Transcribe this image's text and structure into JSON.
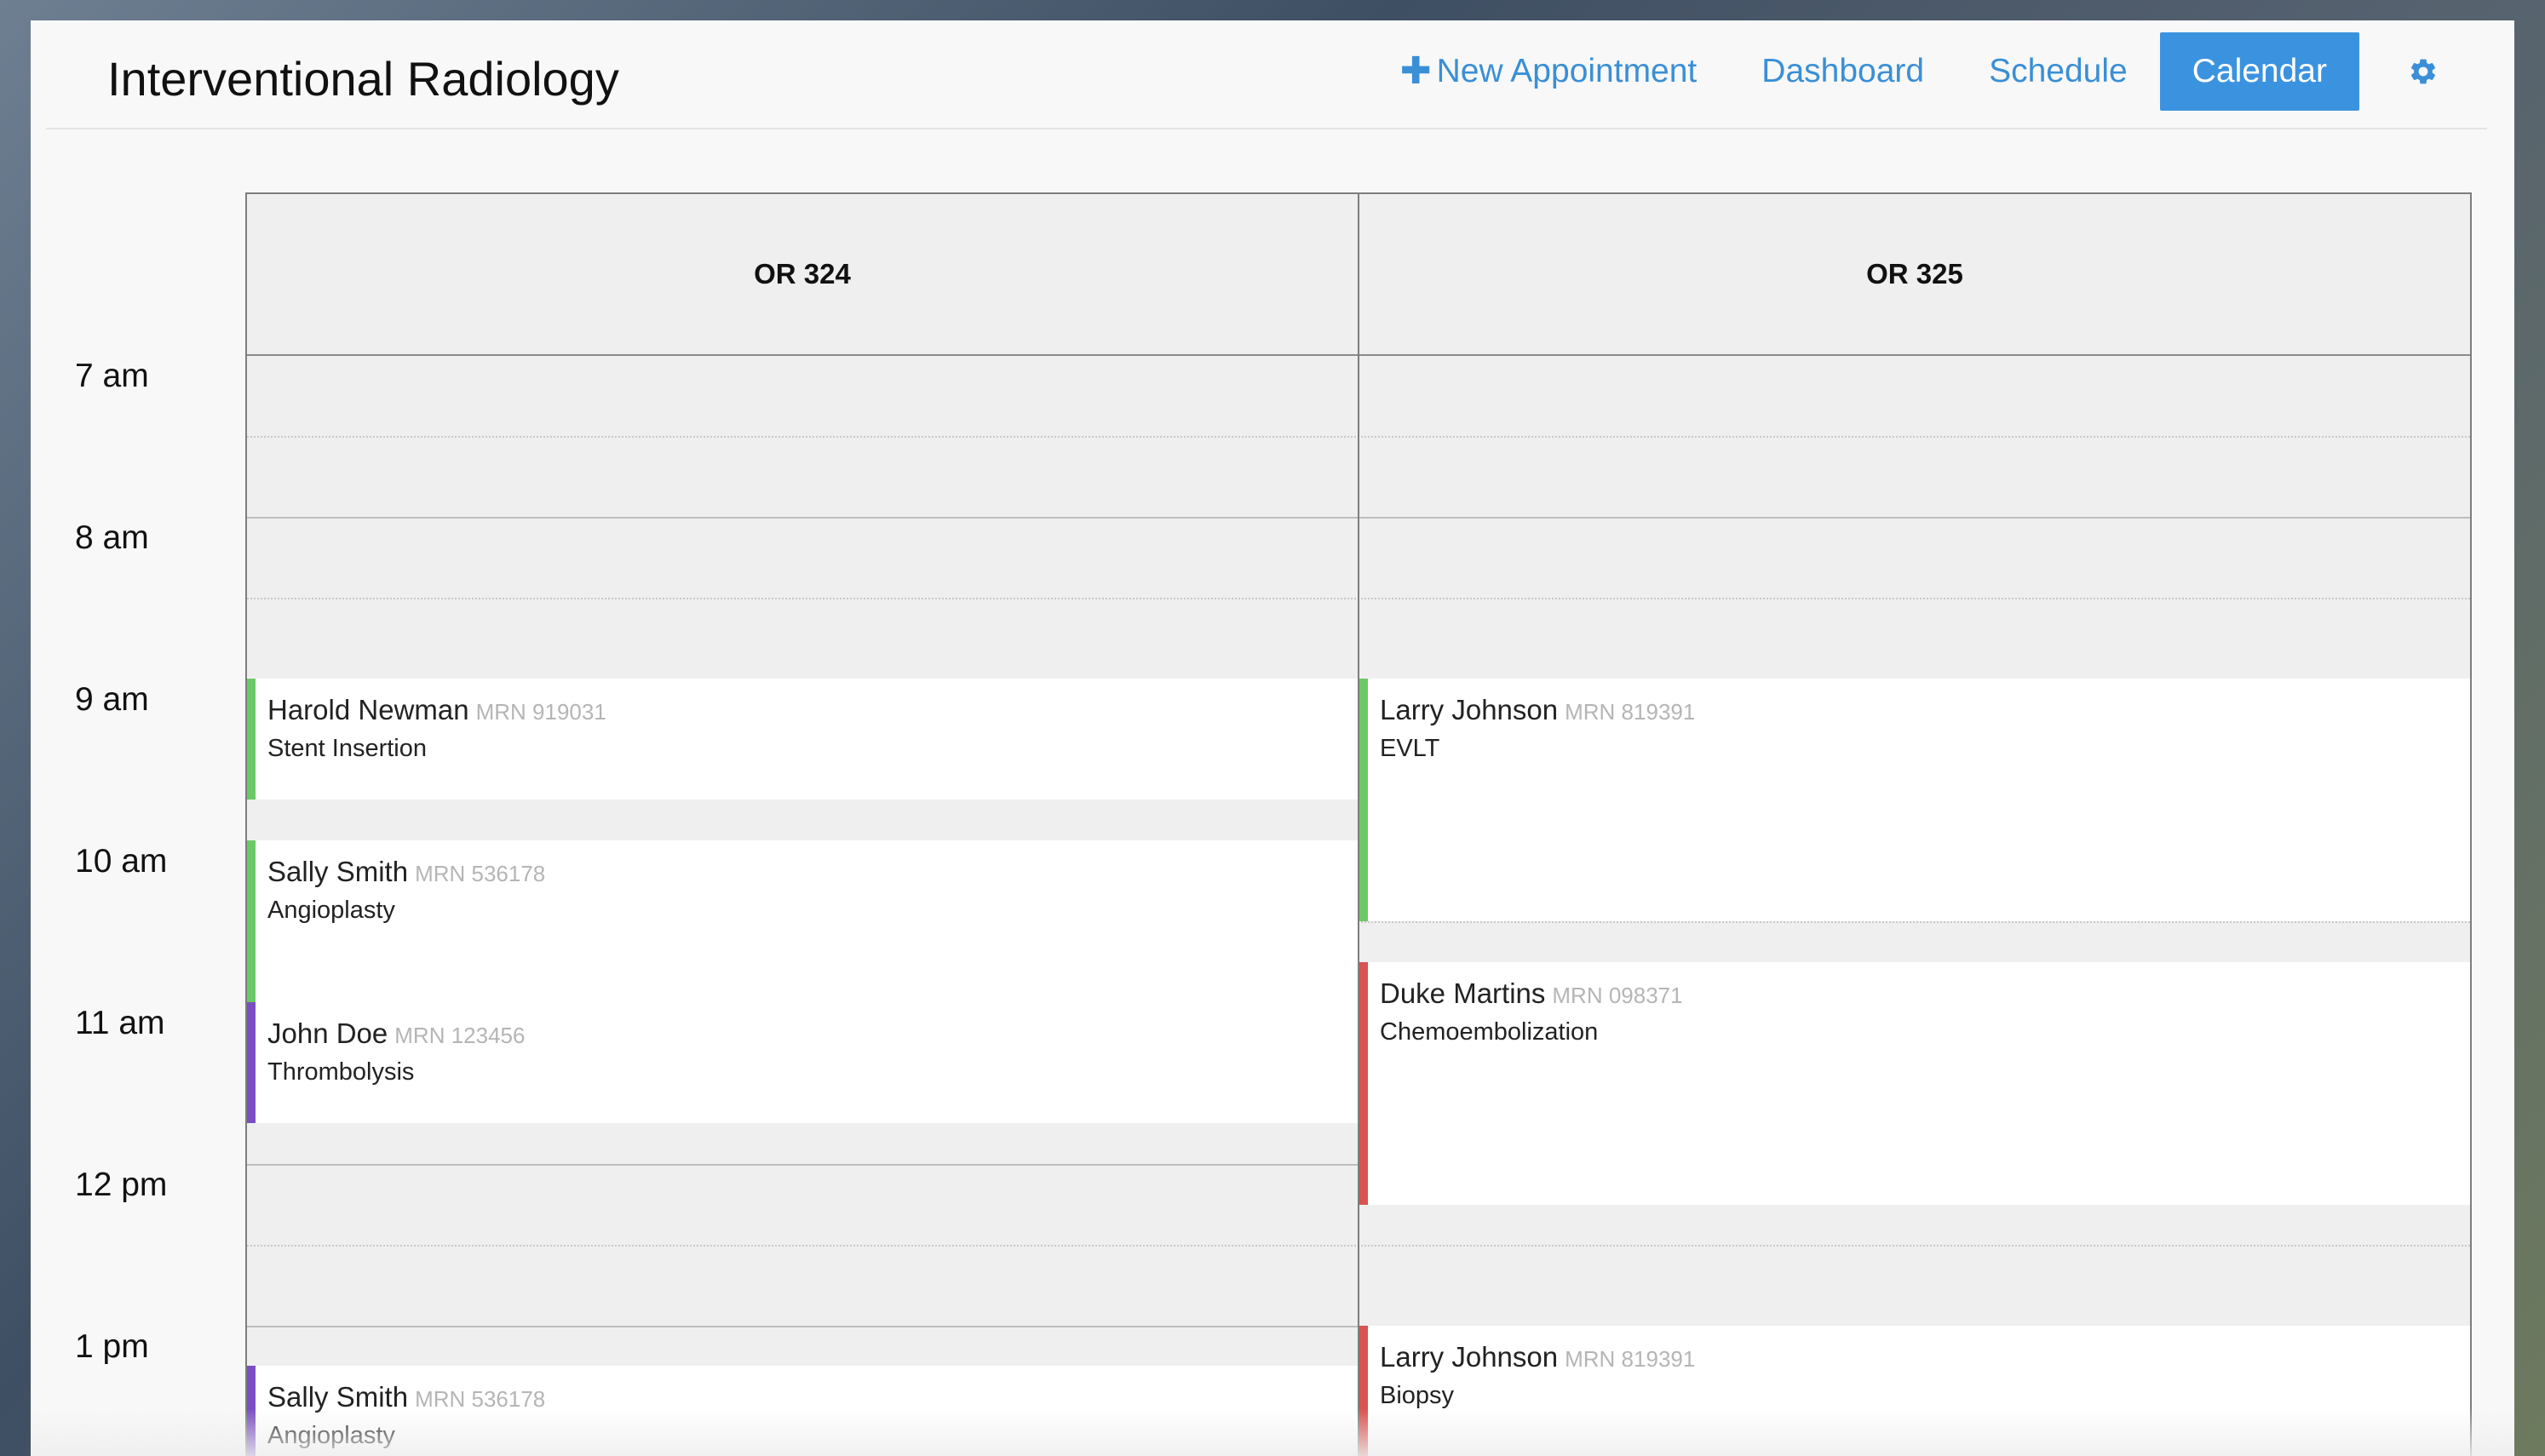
{
  "header": {
    "title": "Interventional Radiology",
    "nav": {
      "new_appointment": "New Appointment",
      "dashboard": "Dashboard",
      "schedule": "Schedule",
      "calendar": "Calendar"
    },
    "active_tab": "Calendar",
    "settings_icon": "gear-icon",
    "new_icon": "plus-icon"
  },
  "calendar": {
    "times": [
      "7 am",
      "8 am",
      "9 am",
      "10 am",
      "11 am",
      "12 pm",
      "1 pm"
    ],
    "rooms": [
      {
        "name": "OR 324",
        "appointments": [
          {
            "name": "Harold Newman",
            "mrn": "MRN 919031",
            "procedure": "Stent Insertion",
            "color": "#6cc965"
          },
          {
            "name": "Sally Smith",
            "mrn": "MRN 536178",
            "procedure": "Angioplasty",
            "color": "#6cc965"
          },
          {
            "name": "John Doe",
            "mrn": "MRN 123456",
            "procedure": "Thrombolysis",
            "color": "#7a4fc2"
          },
          {
            "name": "Sally Smith",
            "mrn": "MRN 536178",
            "procedure": "Angioplasty",
            "color": "#7a4fc2"
          }
        ]
      },
      {
        "name": "OR 325",
        "appointments": [
          {
            "name": "Larry Johnson",
            "mrn": "MRN 819391",
            "procedure": "EVLT",
            "color": "#6cc965"
          },
          {
            "name": "Duke Martins",
            "mrn": "MRN 098371",
            "procedure": "Chemoembolization",
            "color": "#d9534f"
          },
          {
            "name": "Larry Johnson",
            "mrn": "MRN 819391",
            "procedure": "Biopsy",
            "color": "#d9534f"
          }
        ]
      }
    ]
  }
}
